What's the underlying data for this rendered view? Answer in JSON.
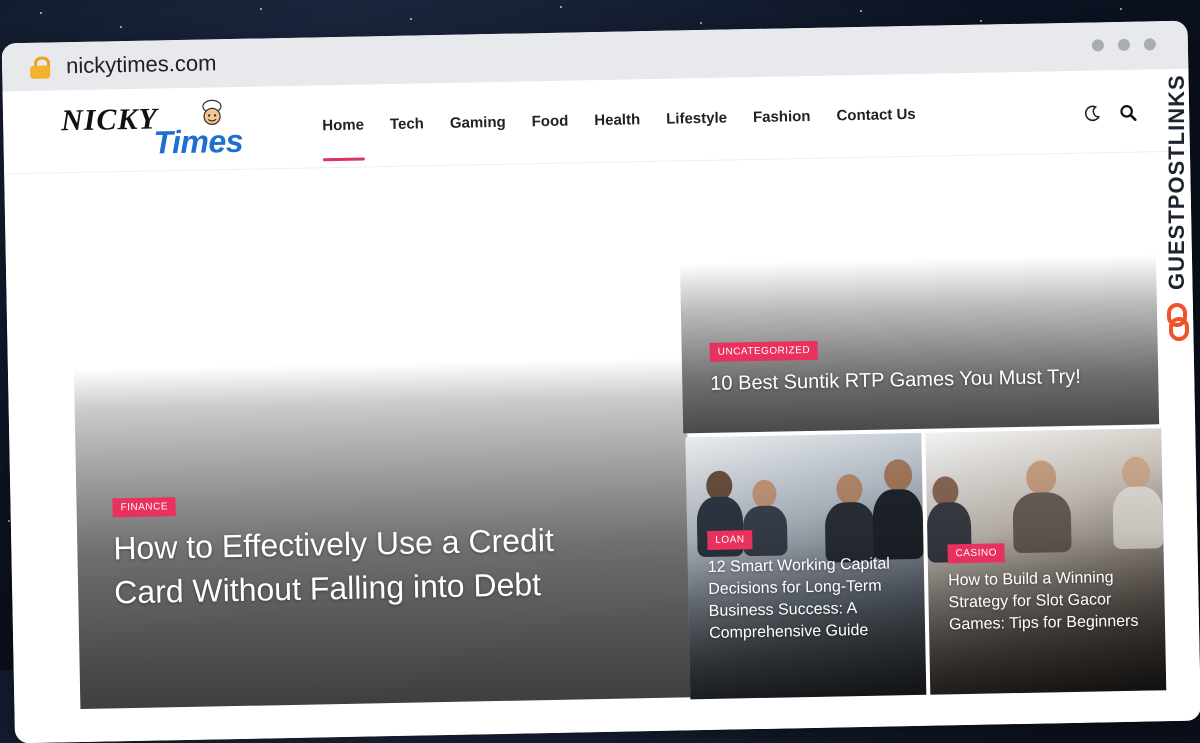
{
  "browser": {
    "url": "nickytimes.com"
  },
  "site": {
    "logo_word1": "NICKY",
    "logo_word2": "Times",
    "nav": [
      {
        "label": "Home",
        "active": true
      },
      {
        "label": "Tech"
      },
      {
        "label": "Gaming"
      },
      {
        "label": "Food"
      },
      {
        "label": "Health"
      },
      {
        "label": "Lifestyle"
      },
      {
        "label": "Fashion"
      },
      {
        "label": "Contact Us"
      }
    ],
    "icons": [
      "moon-icon",
      "search-icon"
    ]
  },
  "featured": {
    "main": {
      "category": "FINANCE",
      "title": "How to Effectively Use a Credit Card Without Falling into Debt"
    },
    "top": {
      "category": "UNCATEGORIZED",
      "title": "10 Best Suntik RTP Games You Must Try!"
    },
    "loan": {
      "category": "LOAN",
      "title": "12 Smart Working Capital Decisions for Long-Term Business Success: A Comprehensive Guide"
    },
    "casino": {
      "category": "CASINO",
      "title": "How to Build a Winning Strategy for Slot Gacor Games: Tips for Beginners"
    }
  },
  "watermark": {
    "brand": "GUESTPOSTLINKS"
  },
  "colors": {
    "accent": "#e8325d",
    "logo_blue": "#1f6fd1",
    "lock": "#f3b22b",
    "watermark_orange": "#f0522a"
  }
}
